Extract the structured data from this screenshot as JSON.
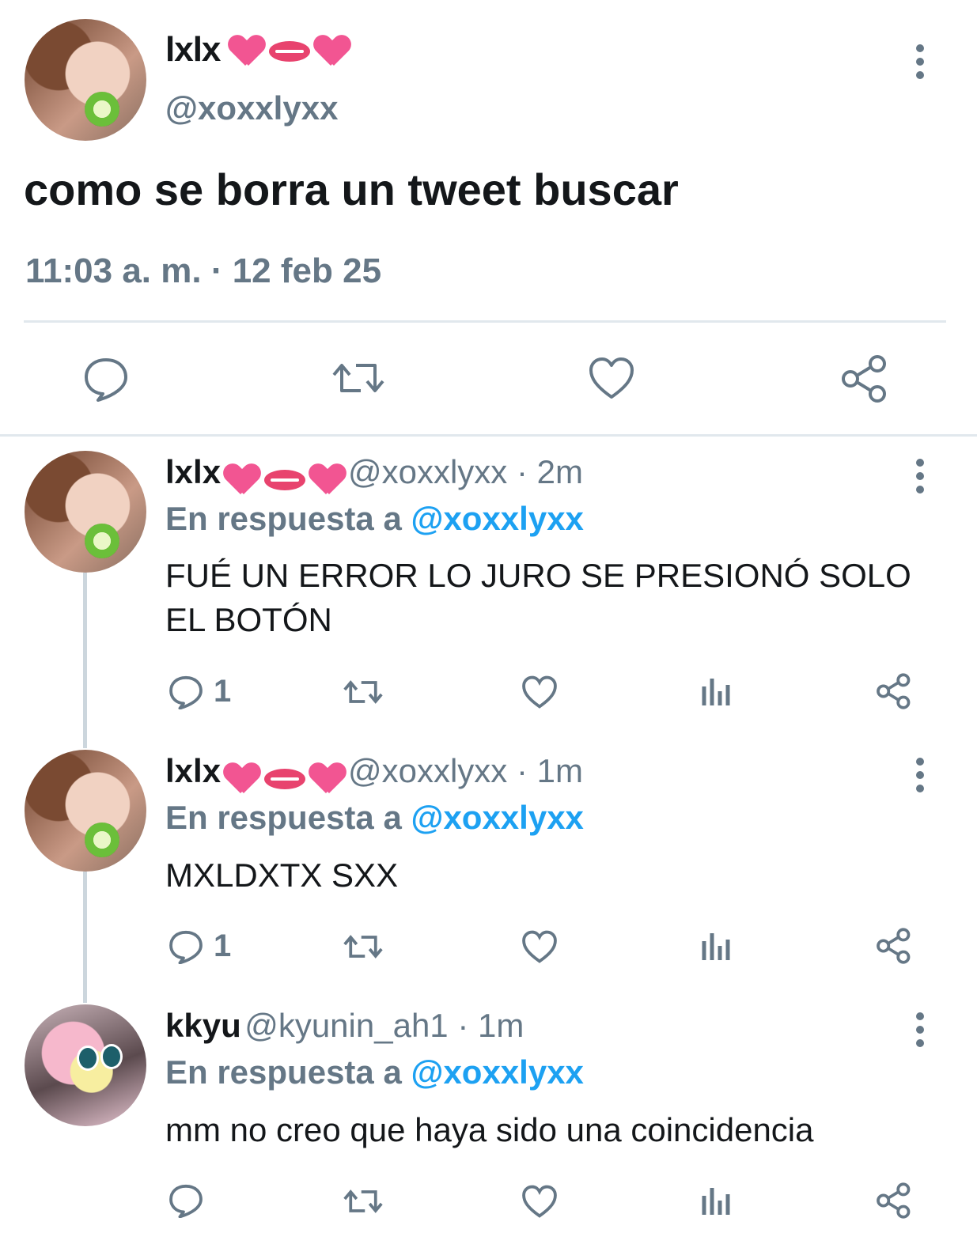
{
  "main_tweet": {
    "display_name": "lxlx",
    "handle": "@xoxxlyxx",
    "text": "como se borra un tweet buscar",
    "timestamp": "11:03 a. m. · 12 feb 25",
    "emojis": [
      "heart-icon",
      "lips-icon",
      "heart-icon"
    ]
  },
  "replies": [
    {
      "display_name": "lxlx",
      "handle_time": "@xoxxlyxx · 2m",
      "reply_prefix": "En respuesta a",
      "reply_to": "@xoxxlyxx",
      "text": "FUÉ UN ERROR LO JURO SE PRESIONÓ SOLO EL BOTÓN",
      "reply_count": "1"
    },
    {
      "display_name": "lxlx",
      "handle_time": "@xoxxlyxx · 1m",
      "reply_prefix": "En respuesta a",
      "reply_to": "@xoxxlyxx",
      "text": "MXLDXTX SXX",
      "reply_count": "1"
    },
    {
      "display_name": "kkyu",
      "handle_time": "@kyunin_ah1 · 1m",
      "reply_prefix": "En respuesta a",
      "reply_to": "@xoxxlyxx",
      "text": "mm no creo que haya sido una coincidencia",
      "reply_count": ""
    }
  ],
  "colors": {
    "text": "#14171a",
    "secondary": "#657786",
    "link": "#1da1f2",
    "divider": "#e1e8ed"
  }
}
